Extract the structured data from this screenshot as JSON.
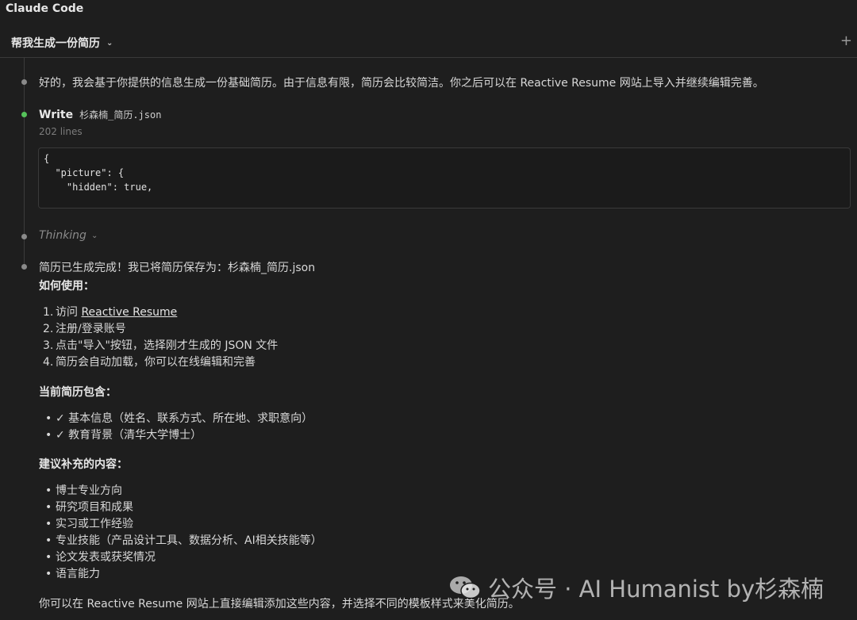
{
  "app": {
    "title": "Claude Code"
  },
  "session": {
    "title": "帮我生成一份简历"
  },
  "messages": {
    "intro": "好的，我会基于你提供的信息生成一份基础简历。由于信息有限，简历会比较简洁。你之后可以在 Reactive Resume 网站上导入并继续编辑完善。",
    "write": {
      "label": "Write",
      "file": "杉森楠_简历.json",
      "lines": "202 lines",
      "code": [
        "{",
        "  \"picture\": {",
        "    \"hidden\": true,"
      ]
    },
    "thinking": "Thinking",
    "done": "简历已生成完成！我已将简历保存为：杉森楠_简历.json",
    "how_to_heading": "如何使用：",
    "steps": [
      {
        "num": "1.",
        "prefix": "访问 ",
        "link": "Reactive Resume",
        "text": ""
      },
      {
        "num": "2.",
        "prefix": "",
        "link": "",
        "text": "注册/登录账号"
      },
      {
        "num": "3.",
        "prefix": "",
        "link": "",
        "text": "点击\"导入\"按钮，选择刚才生成的 JSON 文件"
      },
      {
        "num": "4.",
        "prefix": "",
        "link": "",
        "text": "简历会自动加载，你可以在线编辑和完善"
      }
    ],
    "contains_heading": "当前简历包含：",
    "contains": [
      "✓ 基本信息（姓名、联系方式、所在地、求职意向）",
      "✓ 教育背景（清华大学博士）"
    ],
    "suggest_heading": "建议补充的内容：",
    "suggest": [
      "博士专业方向",
      "研究项目和成果",
      "实习或工作经验",
      "专业技能（产品设计工具、数据分析、AI相关技能等）",
      "论文发表或获奖情况",
      "语言能力"
    ],
    "closing": "你可以在 Reactive Resume 网站上直接编辑添加这些内容，并选择不同的模板样式来美化简历。"
  },
  "watermark": {
    "text": "公众号 · AI Humanist by杉森楠"
  },
  "colors": {
    "background": "#1e1e1e",
    "active_dot": "#55c25a",
    "idle_dot": "#8a8a8a"
  },
  "icons": {
    "chevron": "chevron-down-icon",
    "new_tab": "plus-icon",
    "watermark": "wechat-icon"
  }
}
